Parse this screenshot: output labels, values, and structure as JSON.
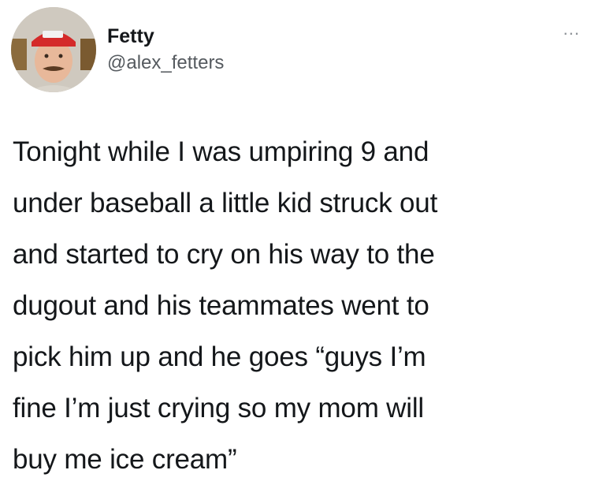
{
  "author": {
    "display_name": "Fetty",
    "handle": "@alex_fetters",
    "avatar": "avatar-photo"
  },
  "header": {
    "more_label": "..."
  },
  "tweet": {
    "text": "Tonight while I was umpiring 9 and\nunder baseball a little kid struck out\nand started to cry on his way to the\ndugout and his teammates went to\npick him up and he goes “guys I’m\nfine I’m just crying so my mom will\nbuy me ice cream”"
  },
  "colors": {
    "background": "#ffffff",
    "text": "#14171a",
    "secondary_text": "#555a5f"
  }
}
